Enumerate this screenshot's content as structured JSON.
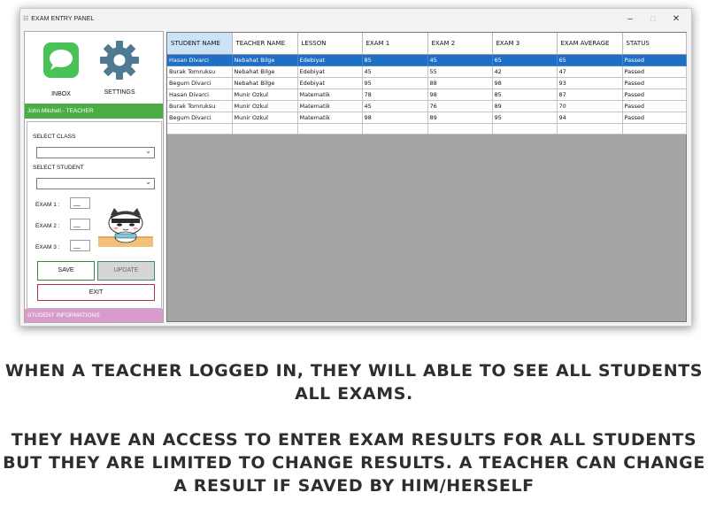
{
  "window": {
    "title": "EXAM ENTRY PANEL",
    "minimize": "–",
    "maximize": "☐",
    "close": "✕"
  },
  "sidebar": {
    "inbox_label": "INBOX",
    "settings_label": "SETTINGS",
    "user_label": "John Mitchell - TEACHER",
    "footer_label": "STUDENT INFORMATIONS",
    "colors": {
      "user_bar": "#4cad46",
      "footer_bar": "#d79ccb",
      "inbox_icon": "#49c257",
      "settings_icon": "#4f7a91"
    }
  },
  "form": {
    "select_class_label": "SELECT CLASS",
    "select_class_value": "",
    "select_student_label": "SELECT STUDENT",
    "select_student_value": "",
    "exam1_label": "EXAM 1 :",
    "exam2_label": "EXAM 2 :",
    "exam3_label": "EXAM 3 :",
    "exam1_value": "__",
    "exam2_value": "__",
    "exam3_value": "__",
    "save_label": "SAVE",
    "update_label": "UPDATE",
    "exit_label": "EXIT"
  },
  "grid": {
    "columns": [
      "STUDENT NAME",
      "TEACHER NAME",
      "LESSON",
      "EXAM 1",
      "EXAM 2",
      "EXAM 3",
      "EXAM AVERAGE",
      "STATUS"
    ],
    "rows": [
      [
        "Hasan Divarci",
        "Nebahat Bilge",
        "Edebiyat",
        "85",
        "45",
        "65",
        "65",
        "Passed"
      ],
      [
        "Burak Tomruksu",
        "Nebahat Bilge",
        "Edebiyat",
        "45",
        "55",
        "42",
        "47",
        "Passed"
      ],
      [
        "Begum Divarci",
        "Nebahat Bilge",
        "Edebiyat",
        "95",
        "88",
        "98",
        "93",
        "Passed"
      ],
      [
        "Hasan Divarci",
        "Munir Ozkul",
        "Matematik",
        "78",
        "98",
        "85",
        "87",
        "Passed"
      ],
      [
        "Burak Tomruksu",
        "Munir Ozkul",
        "Matematik",
        "45",
        "76",
        "89",
        "70",
        "Passed"
      ],
      [
        "Begum Divarci",
        "Munir Ozkul",
        "Matematik",
        "98",
        "89",
        "95",
        "94",
        "Passed"
      ]
    ],
    "selected_row": 0
  },
  "caption": {
    "line1": "WHEN A TEACHER LOGGED IN, THEY WILL ABLE TO SEE ALL STUDENTS",
    "line2": "ALL EXAMS.",
    "line3": "THEY HAVE AN ACCESS TO ENTER EXAM RESULTS FOR ALL STUDENTS",
    "line4": "BUT THEY ARE LIMITED TO CHANGE RESULTS. A TEACHER CAN CHANGE",
    "line5": "A RESULT IF SAVED BY HIM/HERSELF"
  }
}
